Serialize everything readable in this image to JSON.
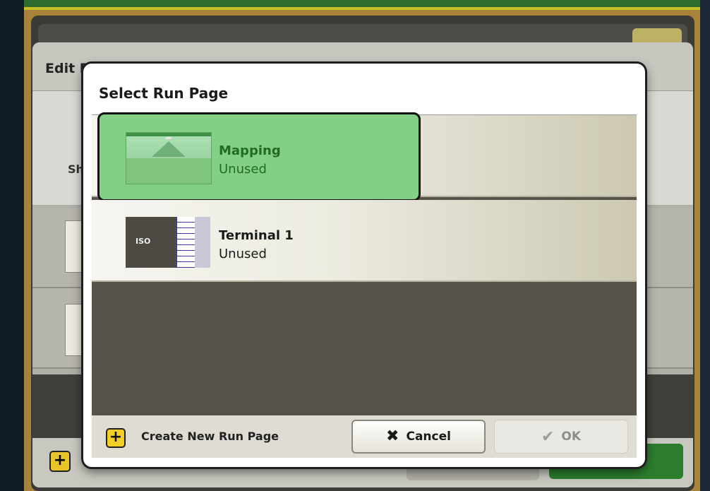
{
  "background": {
    "title": "Edit Run Page Set",
    "row_label_prefix": "Sh"
  },
  "modal": {
    "title": "Select Run Page",
    "items": [
      {
        "name": "Mapping",
        "status": "Unused",
        "icon": "mapping-thumbnail",
        "selected": true
      },
      {
        "name": "Terminal 1",
        "status": "Unused",
        "icon": "iso-terminal-thumbnail",
        "selected": false
      }
    ],
    "terminal_thumb_text": "ISO",
    "footer": {
      "create_icon": "+",
      "create_label": "Create New Run Page",
      "cancel_icon": "✖",
      "cancel_label": "Cancel",
      "ok_icon": "✔",
      "ok_label": "OK"
    }
  },
  "colors": {
    "selected_fill": "#83cf85",
    "selected_text": "#216c24",
    "accent_yellow": "#f1cf25",
    "brand_green": "#2f6b2d"
  }
}
